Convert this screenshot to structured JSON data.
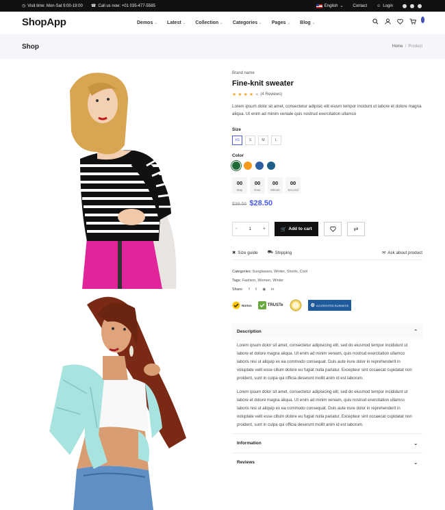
{
  "topbar": {
    "visit_time": "Visit time: Mon-Sat 9:00-19:00",
    "call": "Call us now: +01 035-477-5585",
    "language": "English",
    "contact": "Contact",
    "login": "Login"
  },
  "nav": {
    "logo": "ShopApp",
    "menu": [
      "Demos",
      "Latest",
      "Collection",
      "Categories",
      "Pages",
      "Blog"
    ],
    "cart_count": "0"
  },
  "breadcrumb": {
    "title": "Shop",
    "home": "Home",
    "separator": "/",
    "current": "Product"
  },
  "product": {
    "brand": "Brand name",
    "title": "Fine-knit sweater",
    "rating": 4,
    "reviews": "(4 Reviews)",
    "description": "Lorem ipsum dolor sit amet, consectetur adipisic elit eiusm tempor incidunt ut labore et dolore magna aliqua. Ut enim ad minim veniale quis nostrud exercitation ullamco",
    "size_label": "Size",
    "sizes": [
      "XS",
      "S",
      "M",
      "L"
    ],
    "selected_size": "XS",
    "color_label": "Color",
    "colors": [
      "#1f6b36",
      "#f39a1e",
      "#2f5fa3",
      "#1d5f86"
    ],
    "timer": [
      {
        "value": "00",
        "label": "Day"
      },
      {
        "value": "00",
        "label": "Hour"
      },
      {
        "value": "00",
        "label": "Minute"
      },
      {
        "value": "00",
        "label": "Second"
      }
    ],
    "old_price": "$38.56",
    "price": "$28.50",
    "quantity": "1",
    "add_to_cart": "Add to cart",
    "size_guide": "Size guide",
    "shipping": "Shipping",
    "ask": "Ask about product",
    "categories_label": "Categories:",
    "categories": "Sunglasses, Winter, Shorts, Cool",
    "tags_label": "Tags:",
    "tags": "Fashion, Women, Winter",
    "share_label": "Share:"
  },
  "trust": [
    "Norton",
    "TRUSTe",
    "",
    "ACCREDITED BUSINESS"
  ],
  "accordion": {
    "description_title": "Description",
    "paragraph1": "Lorem ipsum dolor sit amet, consectetur adipisicing elit, sed do eiusmod tempor incididunt ut labore et dolore magna aliqua. Ut enim ad minim veniam, quis nostrud exercitation ullamco laboris nisi ut aliquip ex ea commodo consequat. Duis aute irure dolor in reprehenderit in voluptate velit esse cillum dolore eu fugiat nulla pariatur. Excepteur sint occaecat cupidatat non proident, sunt in culpa qui officia deserunt mollit anim id est laborum.",
    "paragraph2": "Lorem ipsum dolor sit amet, consectetur adipisicing elit, sed do eiusmod tempor incididunt ut labore et dolore magna aliqua. Ut enim ad minim veniam, quis nostrud exercitation ullamco laboris nisi ut aliquip ex ea commodo consequat. Duis aute irure dolor in reprehenderit in voluptate velit esse cillum dolore eu fugiat nulla pariatur. Excepteur sint occaecat cupidatat non proident, sunt in culpa qui officia deserunt mollit anim id est laborum.",
    "information_title": "Information",
    "reviews_title": "Reviews"
  }
}
